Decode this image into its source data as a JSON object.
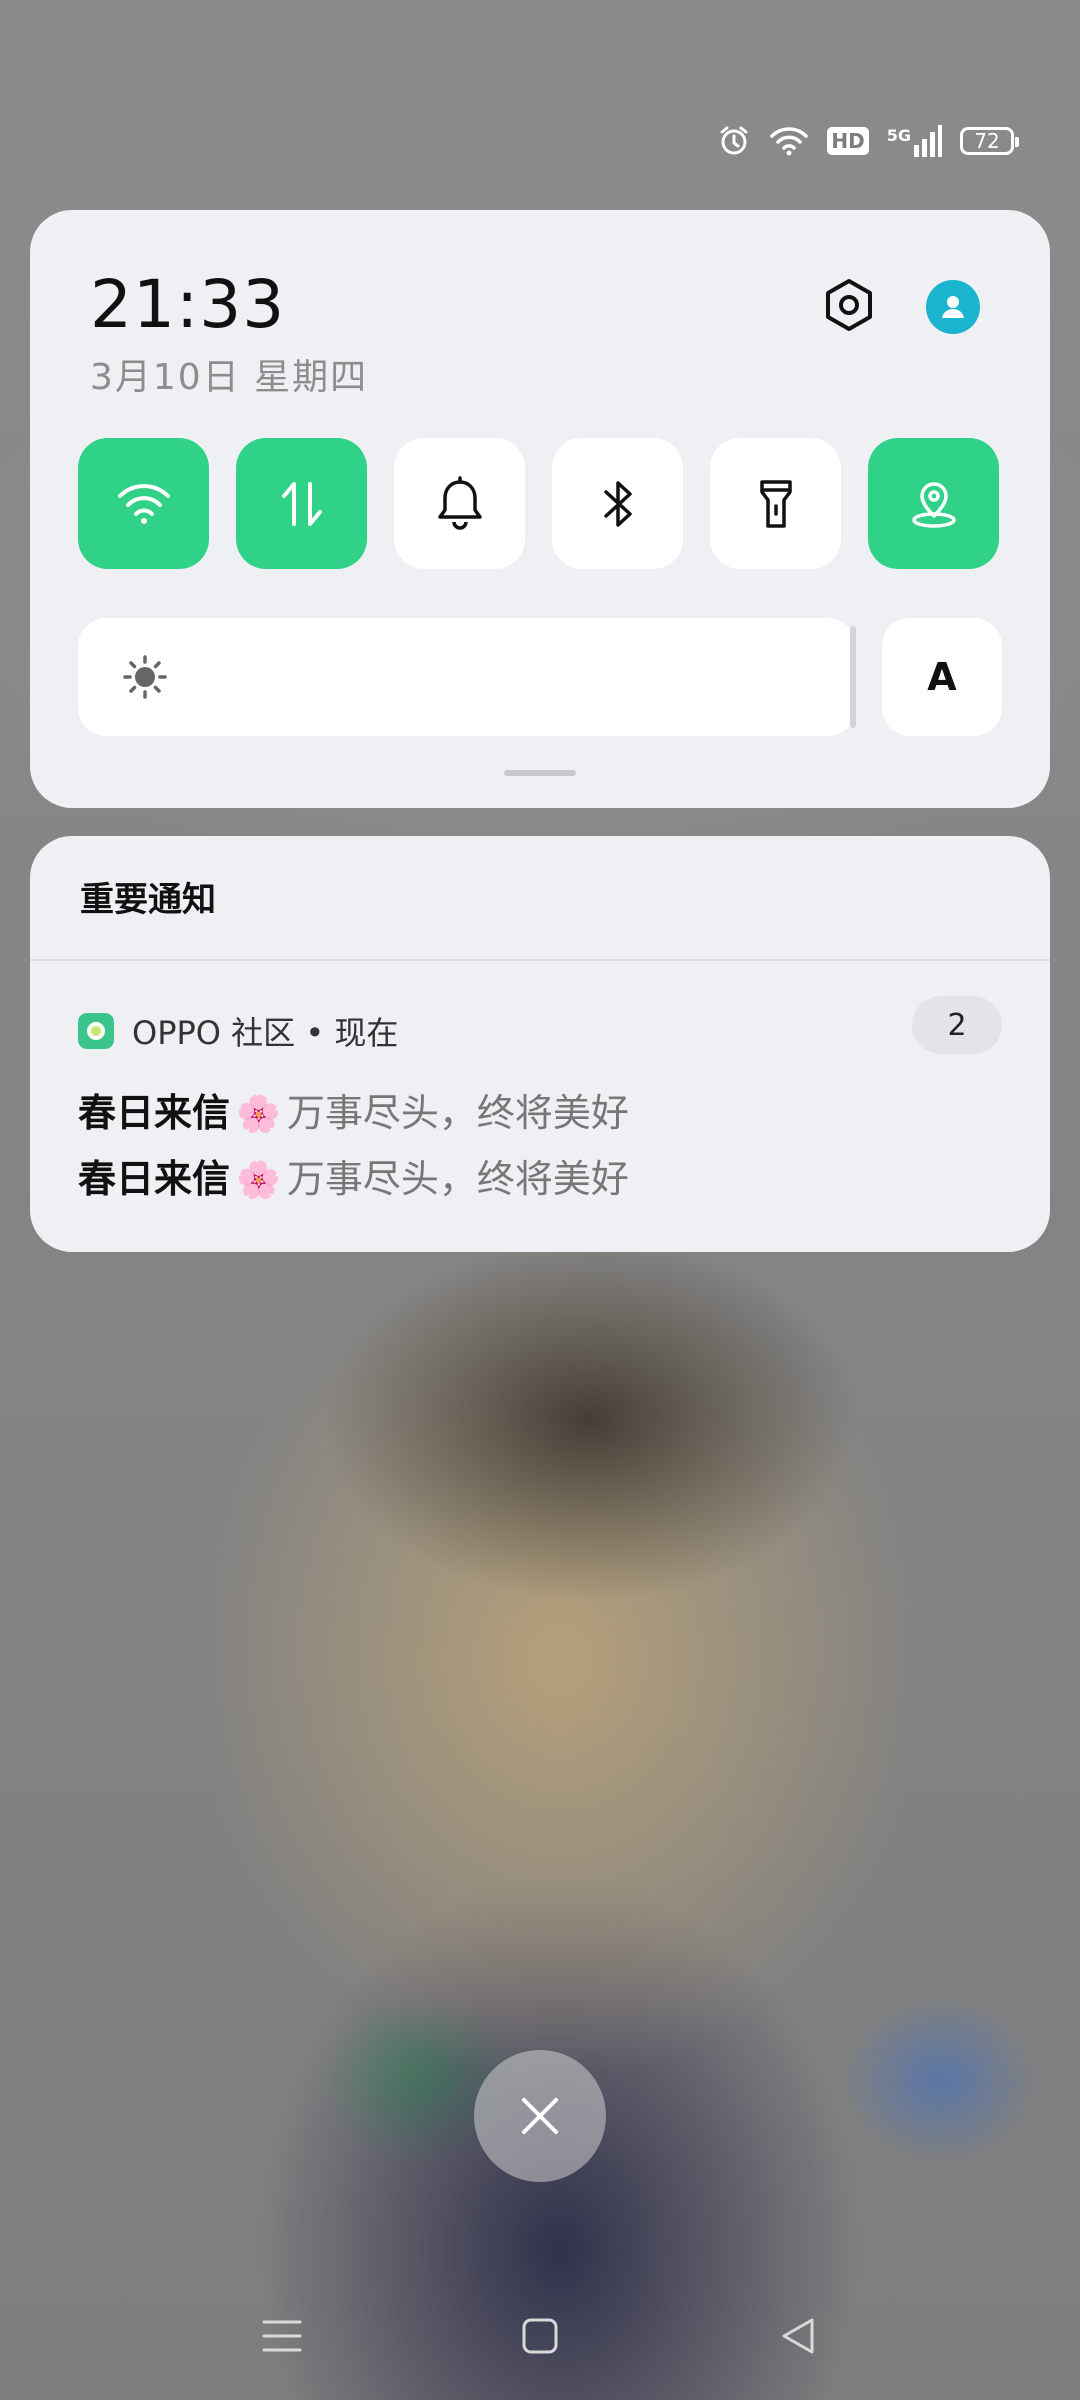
{
  "status_bar": {
    "icons": [
      "alarm-icon",
      "wifi-icon",
      "hd-icon",
      "5g-signal-icon",
      "battery-icon"
    ],
    "hd_label": "HD",
    "network_label": "5G",
    "battery_level": "72"
  },
  "quick_settings": {
    "time": "21:33",
    "date": "3月10日  星期四",
    "settings_icon": "gear-icon",
    "avatar_icon": "user-icon",
    "accent_color": "#2fd286",
    "tiles": [
      {
        "icon": "wifi-icon",
        "active": true
      },
      {
        "icon": "mobile-data-icon",
        "active": true
      },
      {
        "icon": "bell-icon",
        "active": false
      },
      {
        "icon": "bluetooth-icon",
        "active": false
      },
      {
        "icon": "flashlight-icon",
        "active": false
      },
      {
        "icon": "location-icon",
        "active": true
      }
    ],
    "brightness_icon": "sun-icon",
    "brightness_level": 0.99,
    "auto_brightness_label": "A"
  },
  "notifications": {
    "header": "重要通知",
    "app_name": "OPPO 社区 • 现在",
    "count": "2",
    "messages": [
      {
        "title": "春日来信",
        "emoji": "🌸",
        "body": "万事尽头，终将美好"
      },
      {
        "title": "春日来信",
        "emoji": "🌸",
        "body": "万事尽头，终将美好"
      }
    ]
  },
  "close_icon": "close-icon",
  "nav_bar": [
    "menu-icon",
    "home-icon",
    "back-icon"
  ]
}
